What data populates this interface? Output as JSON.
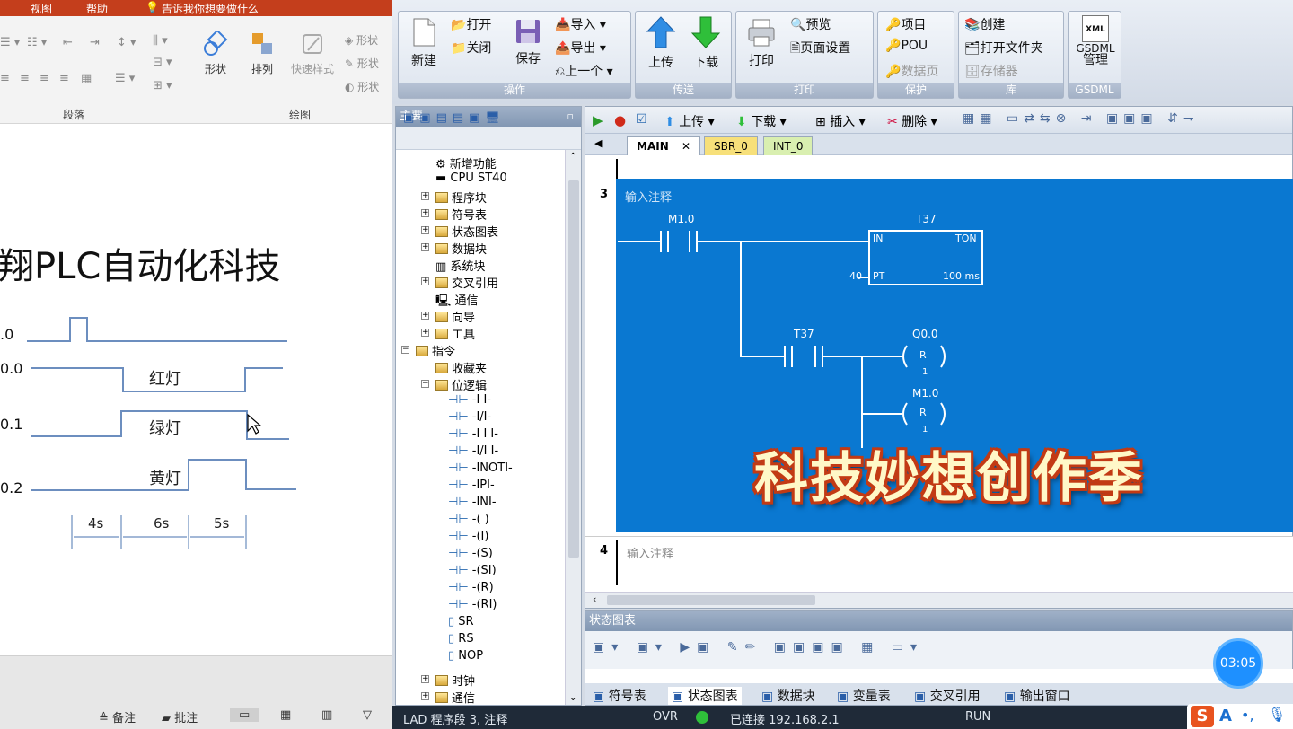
{
  "ppt": {
    "menu": [
      "视图",
      "帮助",
      "告诉我你想要做什么"
    ],
    "ribbon_groups": [
      "段落",
      "绘图"
    ],
    "ribbon_buttons": [
      "形状",
      "排列",
      "快速样式"
    ],
    "side_menu": [
      "形状",
      "形状",
      "形状"
    ],
    "slide_title": "翔PLC自动化科技",
    "timing": {
      "rows": [
        ".0",
        "0.0",
        "0.1",
        "0.2"
      ],
      "lamps": [
        "红灯",
        "绿灯",
        "黄灯"
      ],
      "durations": [
        "4s",
        "6s",
        "5s"
      ]
    },
    "status": [
      "备注",
      "批注"
    ]
  },
  "s7": {
    "ribbon": {
      "groups": [
        "操作",
        "传送",
        "打印",
        "保护",
        "库",
        "GSDML"
      ],
      "new": "新建",
      "open": "打开",
      "close": "关闭",
      "save": "保存",
      "import": "导入",
      "export": "导出",
      "previous": "上一个",
      "upload": "上传",
      "download": "下载",
      "print": "打印",
      "preview": "预览",
      "page_setup": "页面设置",
      "project": "项目",
      "pou": "POU",
      "data_page": "数据页",
      "create": "创建",
      "open_folder": "打开文件夹",
      "memory": "存储器",
      "gsdml_icon": "XML",
      "gsdml_label": "GSDML",
      "gsdml_manage": "管理"
    },
    "tree": {
      "title": "主要",
      "items": [
        "新增功能",
        "CPU ST40",
        "程序块",
        "符号表",
        "状态图表",
        "数据块",
        "系统块",
        "交叉引用",
        "通信",
        "向导",
        "工具",
        "指令",
        "收藏夹",
        "位逻辑"
      ],
      "bit_logic": [
        "-I I-",
        "-I/I-",
        "-I I I-",
        "-I/I I-",
        "-INOTI-",
        "-IPI-",
        "-INI-",
        "-( )",
        "-(I)",
        "-(S)",
        "-(SI)",
        "-(R)",
        "-(RI)",
        "SR",
        "RS",
        "NOP"
      ],
      "bottom_items": [
        "时钟",
        "通信"
      ]
    },
    "editor": {
      "toolbar": {
        "upload": "上传",
        "download": "下载",
        "insert": "插入",
        "delete": "删除"
      },
      "tabs": [
        "MAIN",
        "SBR_0",
        "INT_0"
      ],
      "network3": {
        "number": "3",
        "comment": "输入注释",
        "contact1": "M1.0",
        "timer_name": "T37",
        "timer_type": "TON",
        "timer_in": "IN",
        "timer_pt": "PT",
        "preset": "40",
        "base": "100 ms",
        "contact2": "T37",
        "coil1_addr": "Q0.0",
        "coil1_type": "R",
        "coil1_n": "1",
        "coil2_addr": "M1.0",
        "coil2_type": "R",
        "coil2_n": "1"
      },
      "network4": {
        "number": "4",
        "comment": "输入注释"
      }
    },
    "status_chart": {
      "title": "状态图表",
      "tabs": [
        "符号表",
        "状态图表",
        "数据块",
        "变量表",
        "交叉引用",
        "输出窗口"
      ]
    },
    "statusbar": {
      "left": "LAD 程序段 3, 注释",
      "mode": "OVR",
      "connection": "已连接 192.168.2.1",
      "run": "RUN"
    }
  },
  "overlay": {
    "caption": "科技妙想创作季",
    "timer": "03:05",
    "ime": "A"
  }
}
